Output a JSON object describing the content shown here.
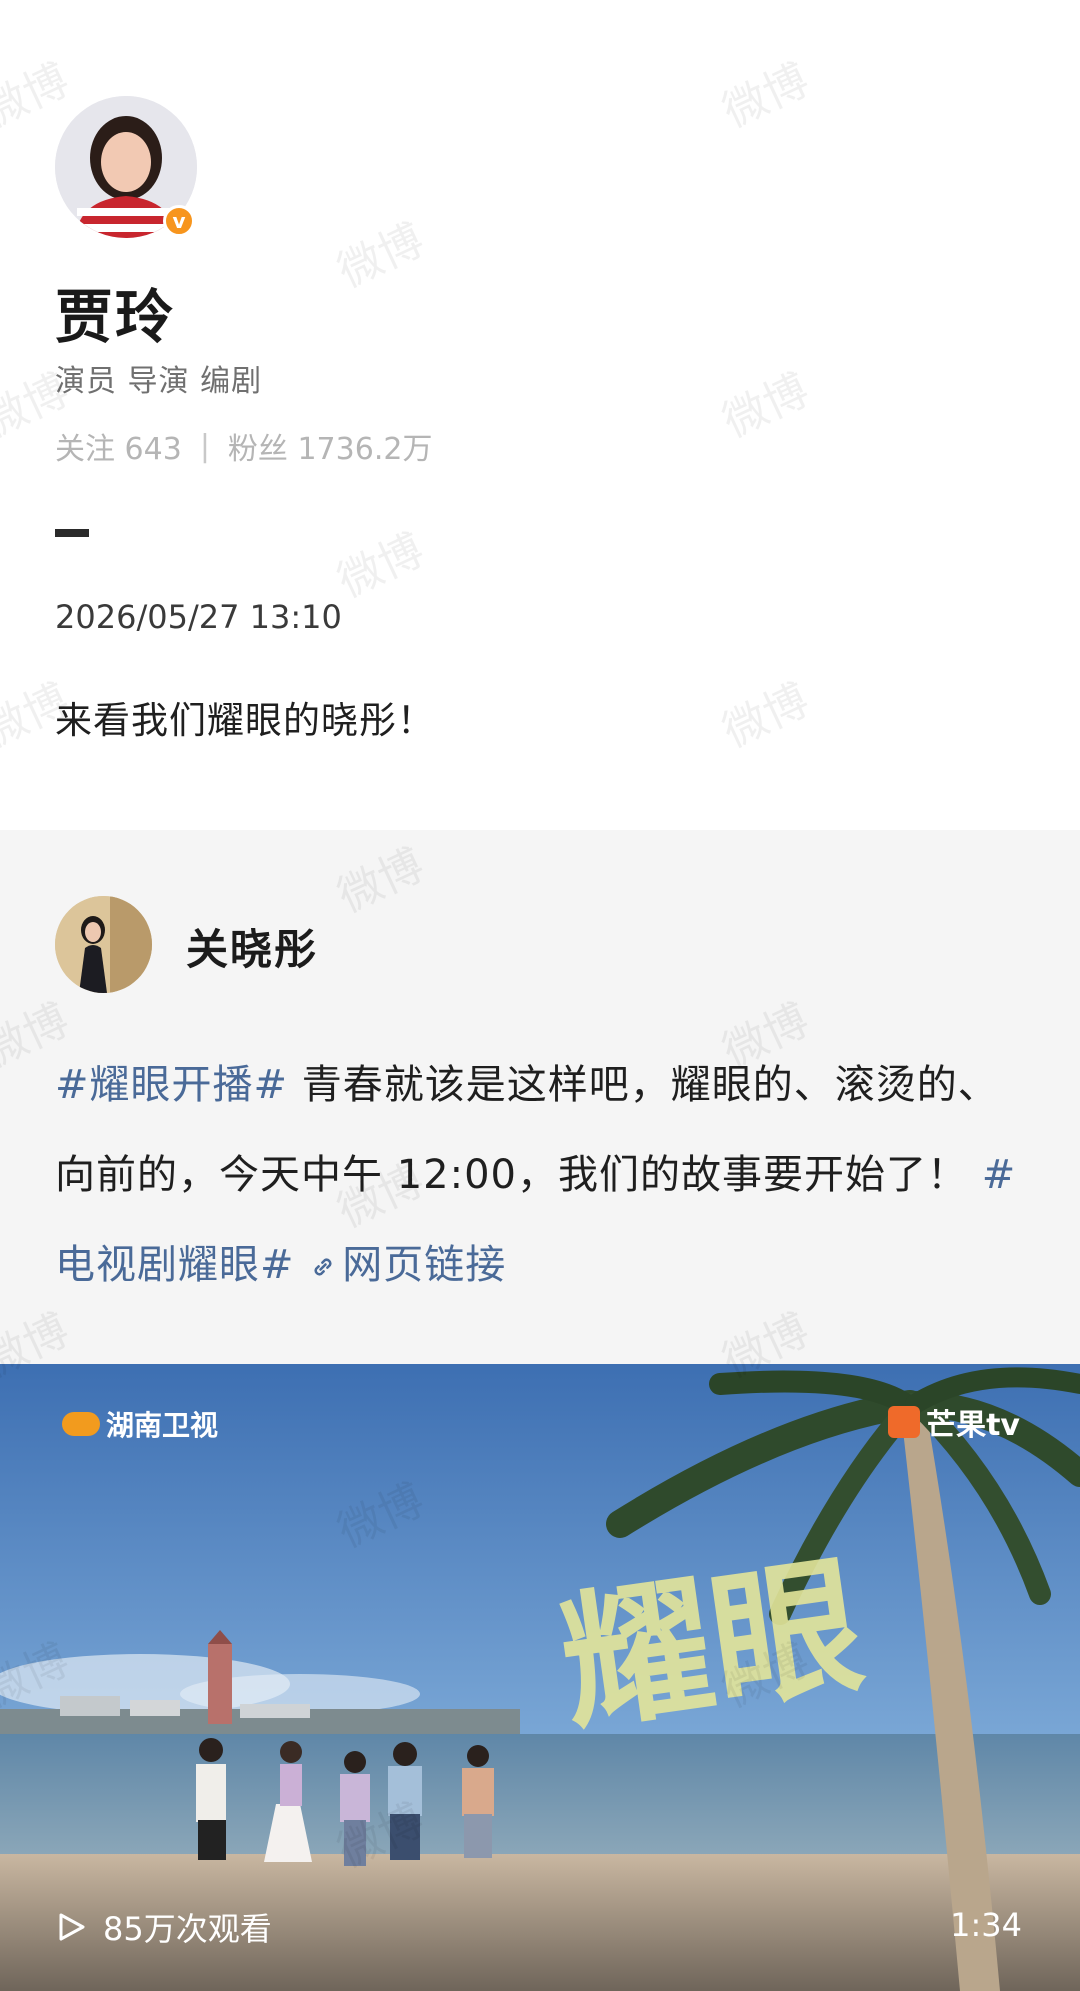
{
  "profile": {
    "name": "贾玲",
    "bio": "演员 导演 编剧",
    "following_label": "关注",
    "following_count": "643",
    "followers_label": "粉丝",
    "followers_count": "1736.2万",
    "verified_icon": "verified-badge-icon"
  },
  "post": {
    "timestamp": "2026/05/27 13:10",
    "text": "来看我们耀眼的晓彤！"
  },
  "repost": {
    "author": "关晓彤",
    "topic1": "#耀眼开播#",
    "body1": " 青春就该是这样吧，耀眼的、滚烫的、向前的，今天中午 12:00，我们的故事要开始了！",
    "topic2": "#电视剧耀眼#",
    "link_text": "网页链接"
  },
  "video": {
    "channel_left": "湖南卫视",
    "channel_right": "芒果tv",
    "views": "85万次观看",
    "duration": "1:34",
    "title_art": "耀眼"
  },
  "watermark": "微博",
  "colors": {
    "topic": "#4a6a98",
    "verified": "#f7951d",
    "repost_bg": "#f5f5f5"
  }
}
